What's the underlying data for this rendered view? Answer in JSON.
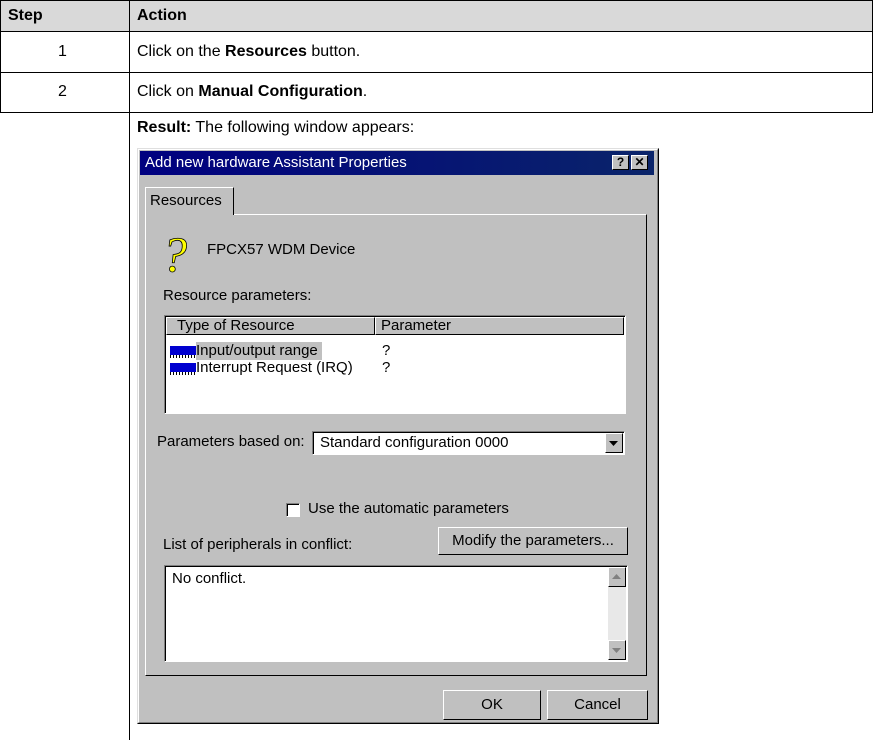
{
  "table": {
    "headers": {
      "step": "Step",
      "action": "Action"
    },
    "rows": [
      {
        "step": "1",
        "action": {
          "pre": "Click on the ",
          "bold": "Resources",
          "post": " button."
        }
      },
      {
        "step": "2",
        "action": {
          "pre": "Click on ",
          "bold": "Manual Configuration",
          "post": "."
        },
        "result": {
          "bold": "Result:",
          "post": " The following window appears:"
        }
      }
    ]
  },
  "dialog": {
    "title": "Add new hardware Assistant Properties",
    "help_label": "?",
    "close_label": "✕",
    "tab_label": "Resources",
    "device_icon": "question-mark-icon",
    "device_name": "FPCX57 WDM Device",
    "resource_params_label": "Resource parameters:",
    "columns": [
      "Type of Resource",
      "Parameter"
    ],
    "resources": [
      {
        "type": "Input/output range",
        "parameter": "?",
        "icon": "memory-icon"
      },
      {
        "type": "Interrupt Request (IRQ)",
        "parameter": "?",
        "icon": "memory-icon"
      }
    ],
    "based_on_label": "Parameters based on:",
    "based_on_value": "Standard configuration 0000",
    "auto_params_label": "Use the automatic parameters",
    "auto_params_checked": false,
    "conflict_label": "List of peripherals in conflict:",
    "modify_button": "Modify the parameters...",
    "conflict_text": "No conflict.",
    "ok_button": "OK",
    "cancel_button": "Cancel"
  },
  "colors": {
    "header_bg": "#d9d9d9",
    "titlebar": "#0a246a",
    "dialog_bg": "#c0c0c0",
    "resource_icon": "#0000d0",
    "question_icon": "#ffff00"
  }
}
